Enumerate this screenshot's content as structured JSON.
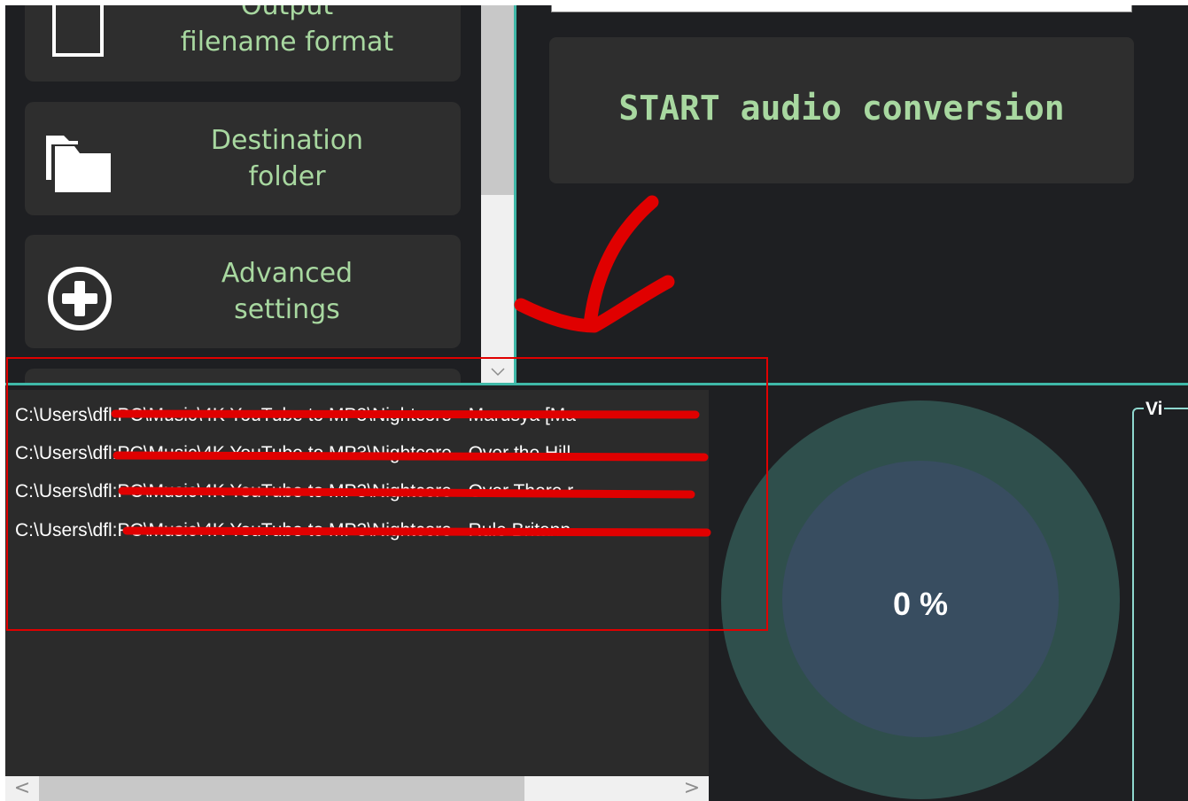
{
  "sidebar": {
    "buttons": [
      {
        "label": "Output\nfilename format",
        "icon": "file-icon"
      },
      {
        "label": "Destination\nfolder",
        "icon": "folder-icon"
      },
      {
        "label": "Advanced\nsettings",
        "icon": "plus-circle-icon"
      }
    ]
  },
  "main": {
    "start_button_label": "START audio conversion"
  },
  "file_list": {
    "items": [
      "C:\\Users\\dfl:PC\\Music\\4K YouTube to MP3\\Nightcore - Marusya [Ma",
      "C:\\Users\\dfl:PC\\Music\\4K YouTube to MP3\\Nightcore - Over the Hill",
      "C:\\Users\\dfl:PC\\Music\\4K YouTube to MP3\\Nightcore - Over There.r",
      "C:\\Users\\dfl:PC\\Music\\4K YouTube to MP3\\Nightcore - Rule Britann"
    ],
    "scroll_left": "<",
    "scroll_right": ">"
  },
  "progress": {
    "text": "0 %",
    "value": 0
  },
  "group_box": {
    "title": "Vi"
  },
  "colors": {
    "accent_green": "#a8d8a0",
    "teal_divider": "#3fb8a8",
    "annotation_red": "#e00000"
  }
}
